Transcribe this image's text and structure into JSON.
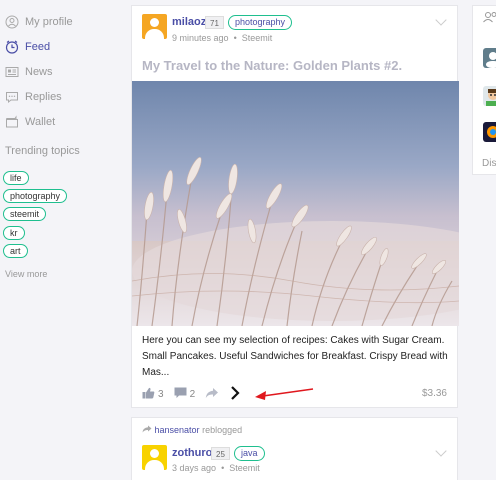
{
  "sidebar": {
    "items": [
      {
        "label": "My profile",
        "icon": "user-icon"
      },
      {
        "label": "Feed",
        "icon": "clock-icon",
        "active": true
      },
      {
        "label": "News",
        "icon": "news-icon"
      },
      {
        "label": "Replies",
        "icon": "chat-icon"
      },
      {
        "label": "Wallet",
        "icon": "wallet-icon"
      }
    ],
    "trending_title": "Trending topics",
    "tags": [
      "life",
      "photography",
      "steemit",
      "kr",
      "art"
    ],
    "view_more": "View more"
  },
  "posts": [
    {
      "author": "milaoz",
      "reputation": "71",
      "category": "photography",
      "time": "9 minutes ago",
      "app": "Steemit",
      "title": "My Travel to the Nature: Golden Plants #2.",
      "excerpt": " Here you can see my selection of recipes:  Cakes with Sugar Cream. Small Pancakes. Useful Sandwiches for Breakfast. Crispy Bread with Mas...",
      "likes": "3",
      "comments": "2",
      "payout": "$3.36",
      "avatar_color": "#f5a623"
    },
    {
      "reblogged_by": "hansenator",
      "reblog_text": "reblogged",
      "author": "zothuro",
      "reputation": "25",
      "category": "java",
      "time": "3 days ago",
      "app": "Steemit",
      "avatar_color": "#f8d200"
    }
  ],
  "right_panel": {
    "label": "Dis"
  },
  "colors": {
    "accent": "#4a4ea6",
    "tag_border": "#1fbf8f",
    "annotation_arrow": "#e0181e"
  }
}
